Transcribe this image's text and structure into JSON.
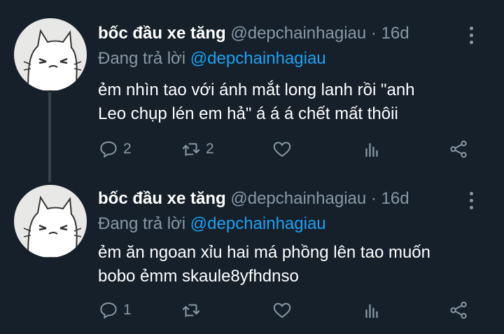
{
  "tweets": [
    {
      "name": "bốc đầu xe tăng",
      "handle": "@depchainhagiau",
      "time": "· 16d",
      "reply_prefix": "Đang trả lời",
      "reply_to": "@depchainhagiau",
      "text_line1": "ẻm nhìn tao với ánh mắt long lanh rồi \"anh",
      "text_line2": "Leo chụp lén em hả\" á á á chết mất thôii",
      "replies": "2",
      "retweets": "2"
    },
    {
      "name": "bốc đầu xe tăng",
      "handle": "@depchainhagiau",
      "time": "· 16d",
      "reply_prefix": "Đang trả lời",
      "reply_to": "@depchainhagiau",
      "text_line1": "ẻm ăn ngoan xỉu hai má phồng lên tao muốn",
      "text_line2": "bobo ẻmm skaule8yfhdnso",
      "replies": "1",
      "retweets": ""
    }
  ],
  "colors": {
    "background": "#15202b",
    "muted": "#8899a6",
    "link": "#1da1f2",
    "text": "#ffffff",
    "thread_line": "#38444d"
  },
  "icons": [
    "reply-icon",
    "retweet-icon",
    "like-icon",
    "analytics-icon",
    "share-icon",
    "more-icon"
  ]
}
